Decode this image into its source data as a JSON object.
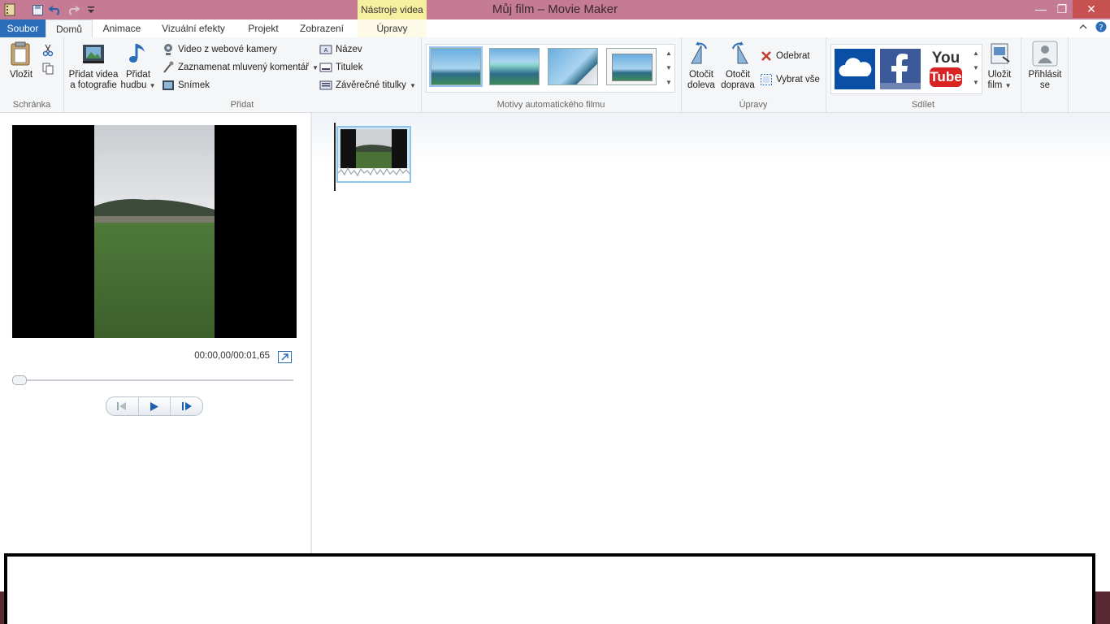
{
  "window": {
    "title": "Můj film – Movie Maker",
    "context_group": "Nástroje videa",
    "controls": {
      "minimize": "—",
      "restore": "❐",
      "close": "✕"
    }
  },
  "tabs": {
    "file": "Soubor",
    "home": "Domů",
    "animations": "Animace",
    "visual_effects": "Vizuální efekty",
    "project": "Projekt",
    "view": "Zobrazení",
    "edit": "Úpravy"
  },
  "ribbon": {
    "clipboard": {
      "label": "Schránka",
      "paste": "Vložit"
    },
    "add": {
      "label": "Přidat",
      "add_videos_line1": "Přidat videa",
      "add_videos_line2": "a fotografie",
      "add_music_line1": "Přidat",
      "add_music_line2": "hudbu",
      "webcam": "Video z webové kamery",
      "narration": "Zaznamenat mluvený komentář",
      "snapshot": "Snímek",
      "title": "Název",
      "caption": "Titulek",
      "credits": "Závěrečné titulky"
    },
    "themes": {
      "label": "Motivy automatického filmu"
    },
    "editing": {
      "label": "Úpravy",
      "rotate_left_line1": "Otočit",
      "rotate_left_line2": "doleva",
      "rotate_right_line1": "Otočit",
      "rotate_right_line2": "doprava",
      "remove": "Odebrat",
      "select_all": "Vybrat vše"
    },
    "share": {
      "label": "Sdílet",
      "save_movie_line1": "Uložit",
      "save_movie_line2": "film",
      "youtube_line1": "You",
      "youtube_line2": "Tube"
    },
    "signin_line1": "Přihlásit",
    "signin_line2": "se"
  },
  "preview": {
    "timecode": "00:00,00/00:01,65",
    "progress": 0
  },
  "colors": {
    "titlebar": "#c47b93",
    "file_tab": "#2c6dba",
    "context_tab": "#f7efa0",
    "clip_border": "#8ec3ea"
  }
}
